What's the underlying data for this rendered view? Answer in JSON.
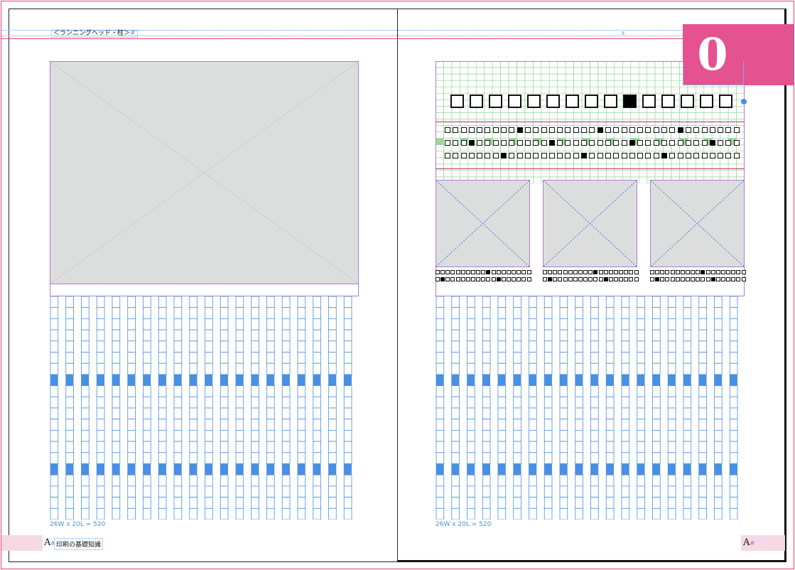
{
  "running_head": "＜ランニングヘッド・柱＞",
  "running_head_mark": "#",
  "chapter_tab": {
    "number": "0",
    "color": "#e4528f"
  },
  "grid_count_left": "26W x 20L = 520",
  "grid_count_right": "26W x 20L = 520",
  "footer_left": {
    "afont": "A",
    "afont_mark": "#",
    "label": "印刷の基礎知識"
  },
  "footer_right": {
    "afont": "A",
    "afont_mark": "#"
  },
  "heading_boxes": {
    "count": 15,
    "filled_index": 9
  },
  "body_rows": [
    {
      "count": 37,
      "filled": [
        9,
        19,
        29
      ]
    },
    {
      "count": 37,
      "filled": [
        3,
        13,
        23,
        33
      ]
    },
    {
      "count": 37,
      "filled": [
        7,
        17,
        27
      ]
    }
  ],
  "caption_rows": [
    {
      "count": 19,
      "filled": [
        10
      ]
    },
    {
      "count": 19,
      "filled": [
        1,
        12
      ]
    }
  ],
  "colors": {
    "bleed": "#e0457b",
    "grid_blue": "#4a90e2",
    "grid_green": "#9ad79a",
    "frame_purple": "#b07cd8",
    "image_gray": "#dcdedd",
    "footer_pink": "#f6d9e5"
  }
}
